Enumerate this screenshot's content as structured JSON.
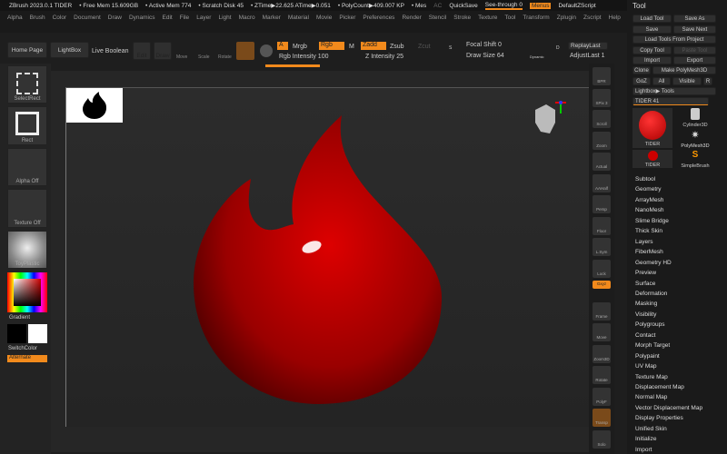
{
  "title": {
    "app": "ZBrush 2023.0.1 TIDER",
    "free_mem": "• Free Mem 15.609GB",
    "active_mem": "• Active Mem 774",
    "scratch": "• Scratch Disk 45",
    "ztime": "• ZTime▶22.625 ATime▶0.051",
    "polycount": "• PolyCount▶409.007 KP",
    "mes": "• Mes",
    "ac": "AC",
    "quicksave": "QuickSave",
    "seethrough": "See-through  0",
    "menus": "Menus",
    "defaultzscript": "DefaultZScript"
  },
  "menu": [
    "Alpha",
    "Brush",
    "Color",
    "Document",
    "Draw",
    "Dynamics",
    "Edit",
    "File",
    "Layer",
    "Light",
    "Macro",
    "Marker",
    "Material",
    "Movie",
    "Picker",
    "Preferences",
    "Render",
    "Stencil",
    "Stroke",
    "Texture",
    "Tool",
    "Transform",
    "Zplugin",
    "Zscript",
    "Help"
  ],
  "shelf": {
    "home": "Home Page",
    "lightbox": "LightBox",
    "liveboolean": "Live Boolean",
    "edit": "Edit",
    "draw": "Draw",
    "move": "Move",
    "scale": "Scale",
    "rotate": "Rotate",
    "a": "A",
    "mrgb": "Mrgb",
    "rgb": "Rgb",
    "m": "M",
    "zadd": "Zadd",
    "zsub": "Zsub",
    "zcut": "Zcut",
    "rgb_intensity": "Rgb Intensity 100",
    "z_intensity": "Z Intensity 25",
    "focal": "Focal Shift 0",
    "drawsize": "Draw Size 64",
    "dynamic": "Dynamic",
    "s": "S",
    "d": "D",
    "replay": "ReplayLast",
    "adjust": "AdjustLast 1"
  },
  "left": {
    "selectrect": "SelectRect",
    "rect": "Rect",
    "alpha": "Alpha Off",
    "texture": "Texture Off",
    "material": "ToyPlastic",
    "gradient": "Gradient",
    "switchcolor": "SwitchColor",
    "alternate": "Alternate"
  },
  "right": [
    "BPR",
    "SPix 3",
    "Scroll",
    "Zoom",
    "Actual",
    "AAHalf",
    "Persp",
    "Floor",
    "L.Sym",
    "Lock",
    "Gxyz",
    "Frame",
    "Move",
    "Zoom3D",
    "Rotate",
    "PolyF",
    "Transp",
    "Solo"
  ],
  "tool": {
    "title": "Tool",
    "load": "Load Tool",
    "saveas": "Save As",
    "save": "Save",
    "savenext": "Save Next",
    "loadproject": "Load Tools From Project",
    "copy": "Copy Tool",
    "paste": "Paste Tool",
    "import": "Import",
    "export": "Export",
    "clone": "Clone",
    "polymesh": "Make PolyMesh3D",
    "goz": "GoZ",
    "all": "All",
    "visible": "Visible",
    "r": "R",
    "lightboxtools": "Lightbox▶ Tools",
    "current": "TIDER  41",
    "thumbs": [
      "TIDER",
      "Cylinder3D",
      "PolyMesh3D",
      "TIDER",
      "SimpleBrush"
    ],
    "subpalettes": [
      "Subtool",
      "Geometry",
      "ArrayMesh",
      "NanoMesh",
      "Slime Bridge",
      "Thick Skin",
      "Layers",
      "FiberMesh",
      "Geometry HD",
      "Preview",
      "Surface",
      "Deformation",
      "Masking",
      "Visibility",
      "Polygroups",
      "Contact",
      "Morph Target",
      "Polypaint",
      "UV Map",
      "Texture Map",
      "Displacement Map",
      "Normal Map",
      "Vector Displacement Map",
      "Display Properties",
      "Unified Skin",
      "Initialize",
      "Import"
    ]
  },
  "colors": {
    "accent": "#f28a1c",
    "model": "#b50000"
  }
}
